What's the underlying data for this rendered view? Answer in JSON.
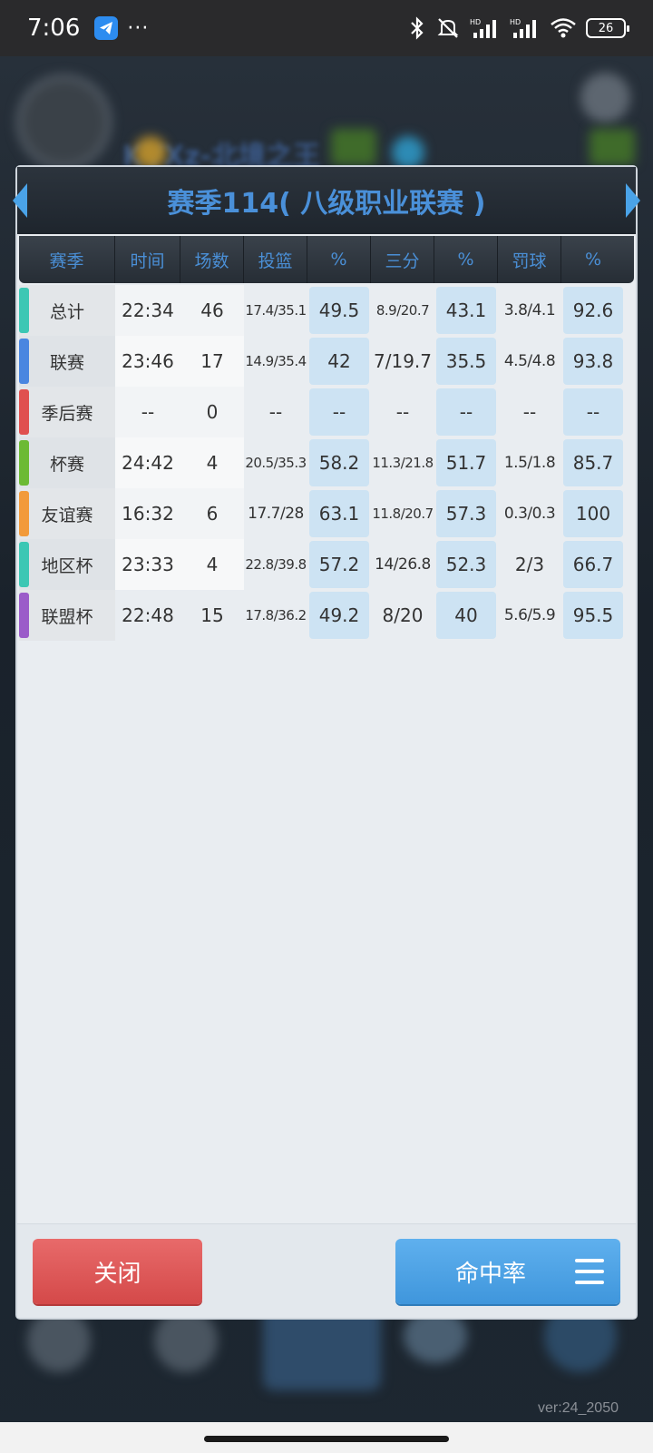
{
  "status_bar": {
    "time": "7:06",
    "dots": "···",
    "battery": "26"
  },
  "background": {
    "player_name": "KYXz-北境之王",
    "version": "ver:24_2050"
  },
  "dialog": {
    "title": "赛季114( 八级职业联赛 )",
    "columns": [
      "赛季",
      "时间",
      "场数",
      "投篮",
      "%",
      "三分",
      "%",
      "罚球",
      "%"
    ],
    "rows": [
      {
        "label": "总计",
        "time": "22:34",
        "games": "46",
        "fg": "17.4/35.1",
        "fg_pct": "49.5",
        "three": "8.9/20.7",
        "three_pct": "43.1",
        "ft": "3.8/4.1",
        "ft_pct": "92.6",
        "color": "#3cc7b4"
      },
      {
        "label": "联赛",
        "time": "23:46",
        "games": "17",
        "fg": "14.9/35.4",
        "fg_pct": "42",
        "three": "7/19.7",
        "three_pct": "35.5",
        "ft": "4.5/4.8",
        "ft_pct": "93.8",
        "color": "#4a86e0"
      },
      {
        "label": "季后赛",
        "time": "--",
        "games": "0",
        "fg": "--",
        "fg_pct": "--",
        "three": "--",
        "three_pct": "--",
        "ft": "--",
        "ft_pct": "--",
        "color": "#e0504f"
      },
      {
        "label": "杯赛",
        "time": "24:42",
        "games": "4",
        "fg": "20.5/35.3",
        "fg_pct": "58.2",
        "three": "11.3/21.8",
        "three_pct": "51.7",
        "ft": "1.5/1.8",
        "ft_pct": "85.7",
        "color": "#6cba34"
      },
      {
        "label": "友谊赛",
        "time": "16:32",
        "games": "6",
        "fg": "17.7/28",
        "fg_pct": "63.1",
        "three": "11.8/20.7",
        "three_pct": "57.3",
        "ft": "0.3/0.3",
        "ft_pct": "100",
        "color": "#f29a3a"
      },
      {
        "label": "地区杯",
        "time": "23:33",
        "games": "4",
        "fg": "22.8/39.8",
        "fg_pct": "57.2",
        "three": "14/26.8",
        "three_pct": "52.3",
        "ft": "2/3",
        "ft_pct": "66.7",
        "color": "#3cc7b4"
      },
      {
        "label": "联盟杯",
        "time": "22:48",
        "games": "15",
        "fg": "17.8/36.2",
        "fg_pct": "49.2",
        "three": "8/20",
        "three_pct": "40",
        "ft": "5.6/5.9",
        "ft_pct": "95.5",
        "color": "#9b5cc9"
      }
    ],
    "close_label": "关闭",
    "rate_label": "命中率"
  },
  "icons": {
    "left": "arrow-left-icon",
    "right": "arrow-right-icon",
    "menu": "menu-icon"
  }
}
